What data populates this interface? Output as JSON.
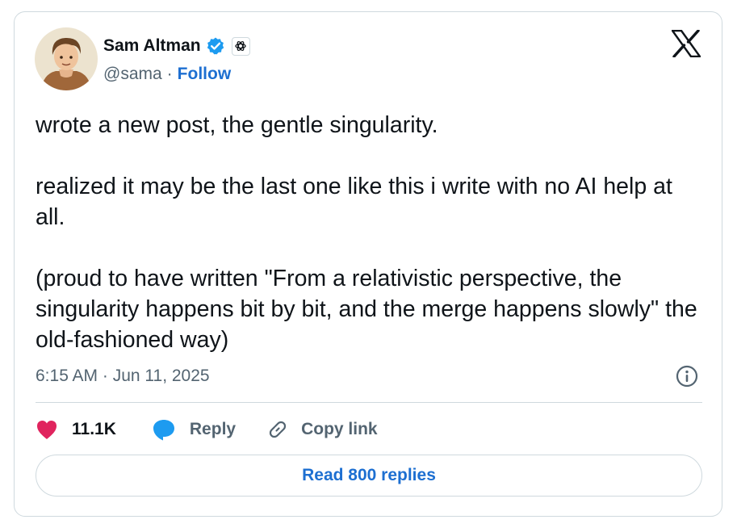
{
  "author": {
    "name": "Sam Altman",
    "handle": "@sama",
    "separator": "·",
    "follow_label": "Follow"
  },
  "post": {
    "text": "wrote a new post, the gentle singularity.\n\nrealized it may be the last one like this i write with no AI help at all.\n\n(proud to have written \"From a relativistic perspective, the singularity happens bit by bit, and the merge happens slowly\" the old-fashioned way)",
    "timestamp": "6:15 AM · Jun 11, 2025"
  },
  "actions": {
    "likes": "11.1K",
    "reply_label": "Reply",
    "copy_link_label": "Copy link"
  },
  "read_replies_label": "Read 800 replies",
  "icons": [
    "avatar",
    "verified-badge-icon",
    "openai-affiliate-icon",
    "x-logo-icon",
    "info-icon",
    "heart-icon",
    "reply-icon",
    "link-icon"
  ],
  "colors": {
    "accent": "#1d6fd1",
    "heart": "#e0245e",
    "muted": "#536471",
    "border": "#cfd9de",
    "verified": "#1d9bf0"
  }
}
